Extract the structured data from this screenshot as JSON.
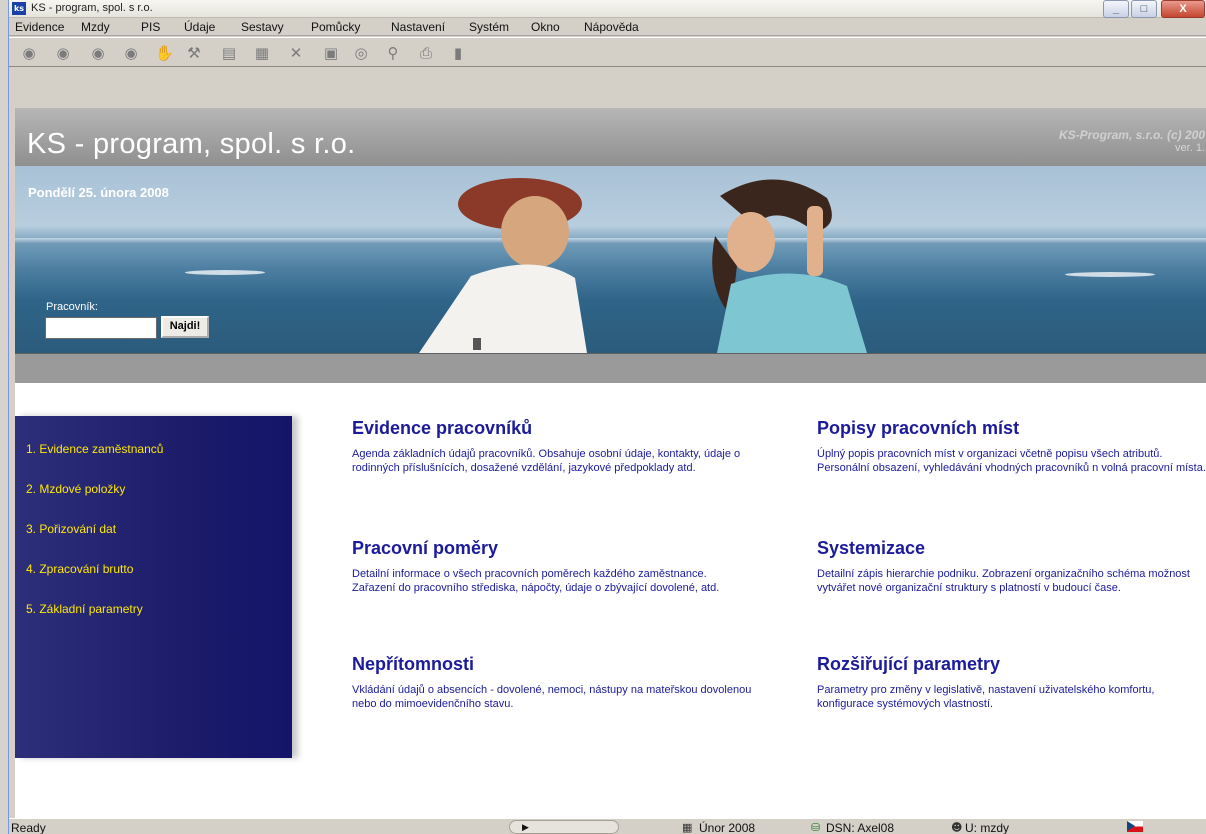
{
  "window": {
    "title": "KS - program, spol. s r.o.",
    "buttons": {
      "minimize": "_",
      "maximize": "□",
      "close": "X"
    }
  },
  "menu": [
    "Evidence",
    "Mzdy",
    "PIS",
    "Údaje",
    "Sestavy",
    "Pomůcky",
    "Nastavení",
    "Systém",
    "Okno",
    "Nápověda"
  ],
  "toolbar": {
    "icons": [
      "record-icon",
      "record-icon",
      "record-icon",
      "record-icon",
      "hand-icon",
      "tools-icon",
      "document-icon",
      "notes-icon",
      "cut-icon",
      "save-icon",
      "disc-icon",
      "search-icon",
      "print-icon",
      "exit-icon"
    ]
  },
  "header": {
    "app_title": "KS - program, spol. s r.o.",
    "copyright": "KS-Program, s.r.o. (c) 200",
    "version": "ver. 1."
  },
  "banner": {
    "date": "Pondělí 25. února 2008",
    "worker_label": "Pracovník:",
    "worker_value": "",
    "find_button": "Najdi!"
  },
  "nav": [
    "1. Evidence zaměstnanců",
    "2. Mzdové položky",
    "3. Pořizování dat",
    "4. Zpracování brutto",
    "5. Základní parametry"
  ],
  "features": [
    {
      "title": "Evidence pracovníků",
      "desc": "Agenda základních údajů pracovníků. Obsahuje osobní údaje, kontakty, údaje o rodinných příslušnících, dosažené vzdělání, jazykové předpoklady atd."
    },
    {
      "title": "Popisy pracovních míst",
      "desc": "Úplný popis pracovních míst v organizaci včetně popisu všech atributů. Personální obsazení, vyhledávání vhodných pracovníků n volná pracovní místa."
    },
    {
      "title": "Pracovní poměry",
      "desc": "Detailní informace o všech pracovních poměrech každého zaměstnance. Zařazení do pracovního střediska, nápočty, údaje o zbývající dovolené, atd."
    },
    {
      "title": "Systemizace",
      "desc": "Detailní zápis hierarchie podniku. Zobrazení organizačního schéma možnost vytvářet nové organizační struktury s platností v budoucí čase."
    },
    {
      "title": "Nepřítomnosti",
      "desc": "Vkládání údajů o absencích - dovolené, nemoci, nástupy na mateřskou dovolenou nebo do mimoevidenčního stavu."
    },
    {
      "title": "Rozšiřující parametry",
      "desc": "Parametry pro změny v legislativě, nastavení uživatelského komfortu, konfigurace systémových vlastností."
    }
  ],
  "status": {
    "ready": "Ready",
    "month": "Únor 2008",
    "dsn": "DSN: Axel08",
    "user": "U: mzdy"
  }
}
